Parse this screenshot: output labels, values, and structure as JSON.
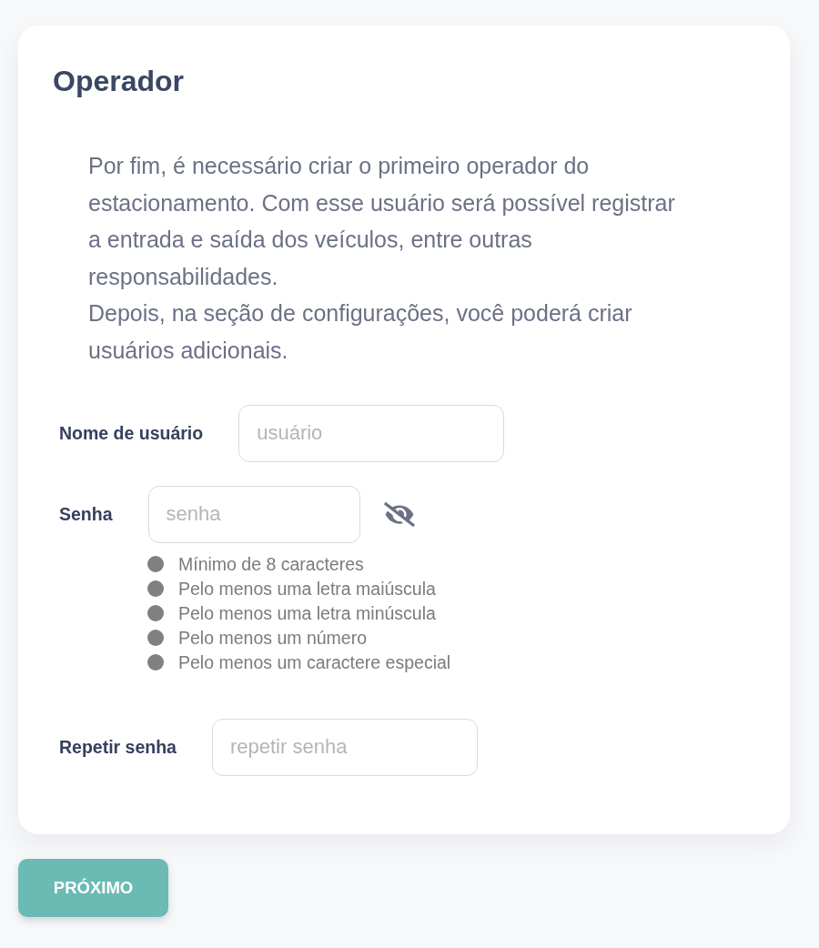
{
  "card": {
    "title": "Operador",
    "paragraphs": [
      "Por fim, é necessário criar o primeiro operador do estacionamento. Com esse usuário será possível registrar a entrada e saída dos veículos, entre outras responsabilidades.",
      "Depois, na seção de configurações, você poderá criar usuários adicionais."
    ],
    "fields": [
      {
        "label": "Nome de usuário",
        "placeholder": "usuário"
      },
      {
        "label": "Senha",
        "placeholder": "senha",
        "password_visible": false,
        "requirements": [
          {
            "text": "Mínimo de 8 caracteres",
            "met": false
          },
          {
            "text": "Pelo menos uma letra maiúscula",
            "met": false
          },
          {
            "text": "Pelo menos uma letra minúscula",
            "met": false
          },
          {
            "text": "Pelo menos um número",
            "met": false
          },
          {
            "text": "Pelo menos um caractere especial",
            "met": false
          }
        ]
      },
      {
        "label": "Repetir senha",
        "placeholder": "repetir senha"
      }
    ]
  },
  "next_button": {
    "label": "PRÓXIMO"
  }
}
